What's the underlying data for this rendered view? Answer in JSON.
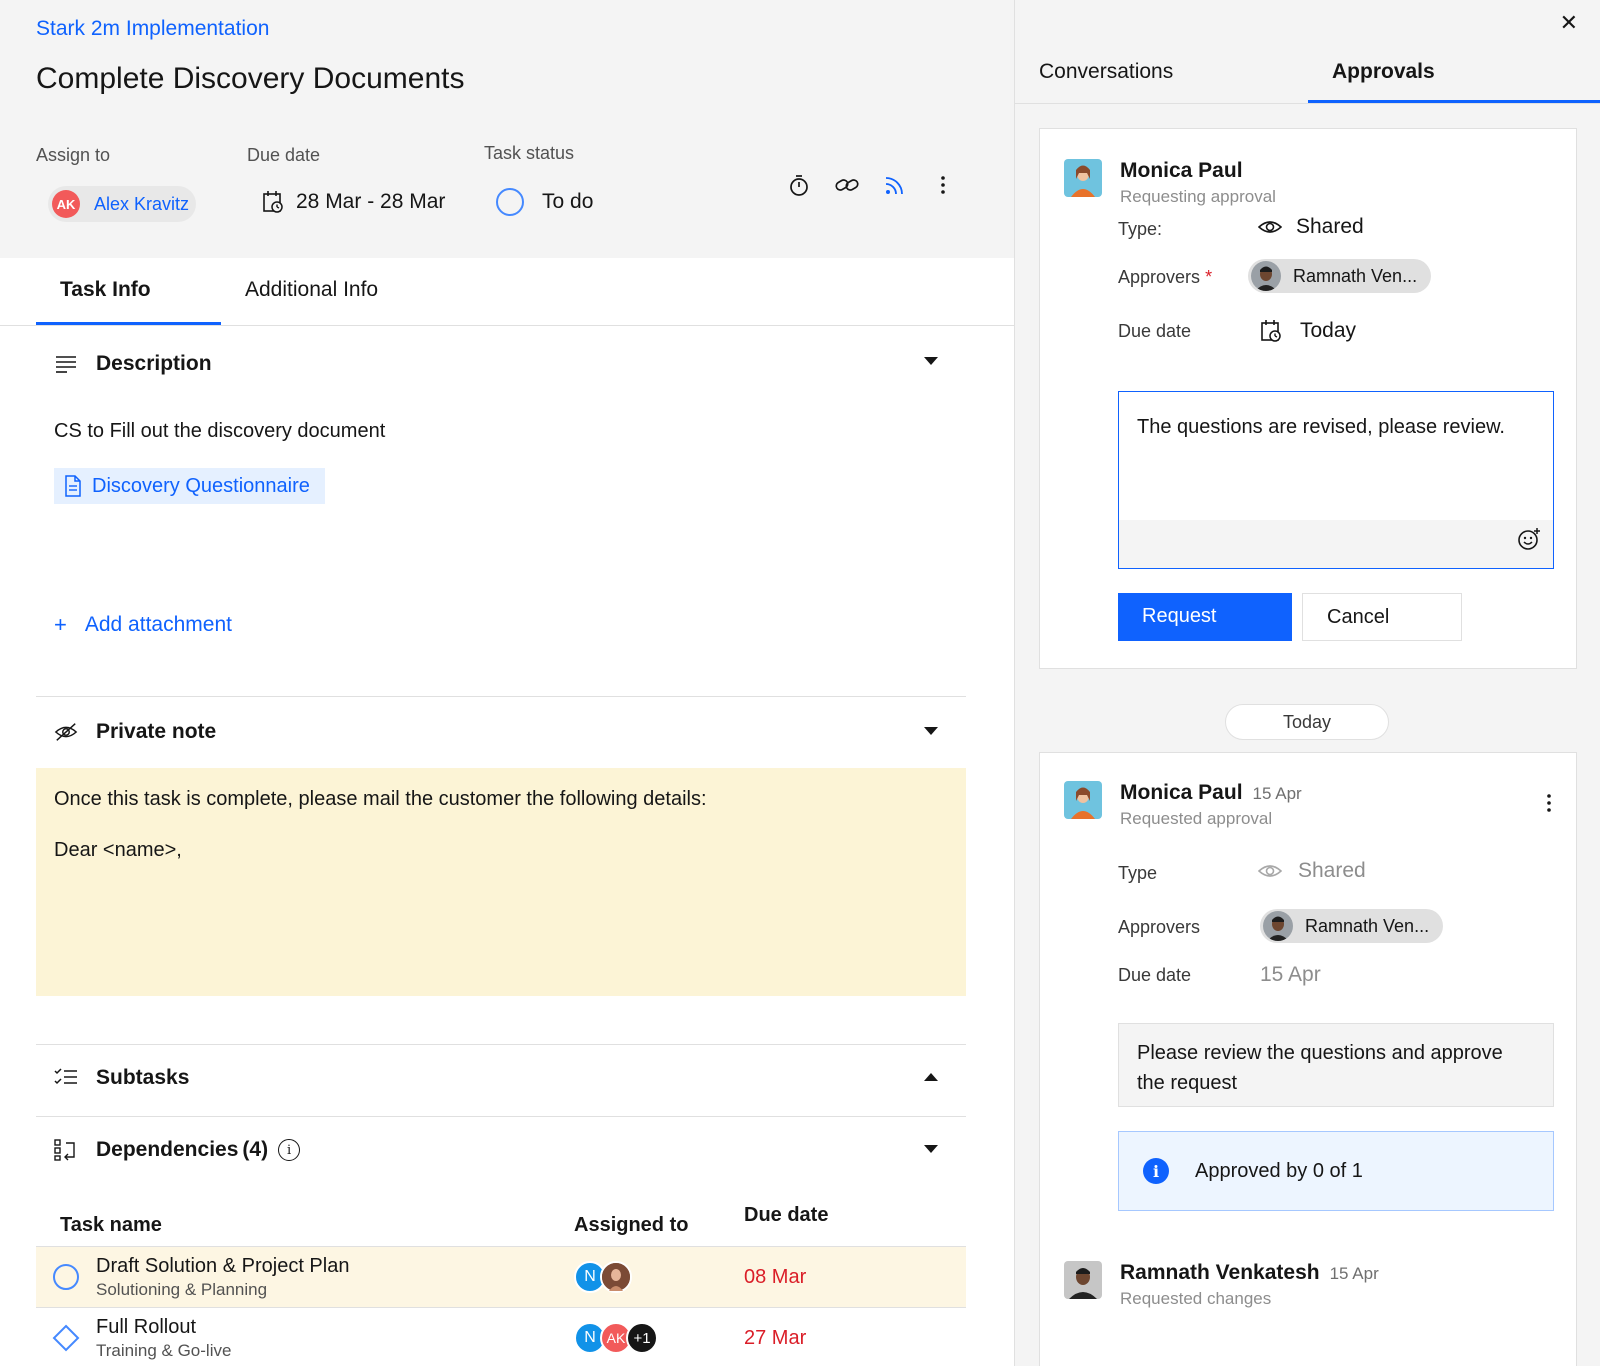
{
  "header": {
    "breadcrumb": "Stark 2m Implementation",
    "title": "Complete Discovery Documents",
    "assign_label": "Assign to",
    "assignee_initials": "AK",
    "assignee_name": "Alex Kravitz",
    "due_label": "Due date",
    "due_value": "28 Mar - 28 Mar",
    "status_label": "Task status",
    "status_value": "To do",
    "icons": [
      "timer-icon",
      "link-icon",
      "rss-icon",
      "overflow-menu-icon"
    ]
  },
  "tabs": [
    {
      "label": "Task Info",
      "active": true
    },
    {
      "label": "Additional Info",
      "active": false
    }
  ],
  "description": {
    "heading": "Description",
    "text": "CS to Fill out the discovery document",
    "attachment": "Discovery Questionnaire",
    "add_attachment": "Add attachment"
  },
  "private_note": {
    "heading": "Private note",
    "line1": "Once this task is complete, please mail the customer the following details:",
    "line2": "Dear <name>,"
  },
  "subtasks": {
    "heading": "Subtasks"
  },
  "dependencies": {
    "heading": "Dependencies",
    "count": "(4)",
    "columns": [
      "Task name",
      "Assigned to",
      "Due date"
    ],
    "rows": [
      {
        "name": "Draft Solution & Project Plan",
        "sub": "Solutioning & Planning",
        "assignees": [
          "N"
        ],
        "due": "08 Mar",
        "icon": "circle"
      },
      {
        "name": "Full Rollout",
        "sub": "Training & Go-live",
        "assignees": [
          "N",
          "AK",
          "+1"
        ],
        "due": "27 Mar",
        "icon": "diamond"
      }
    ]
  },
  "right": {
    "tabs": [
      {
        "label": "Conversations",
        "active": false
      },
      {
        "label": "Approvals",
        "active": true
      }
    ],
    "request_card": {
      "name": "Monica Paul",
      "sub": "Requesting approval",
      "type_label": "Type",
      "type_colon": ":",
      "type_value": "Shared",
      "approvers_label": "Approvers",
      "required_mark": "*",
      "approver": "Ramnath Ven...",
      "due_label": "Due date",
      "due_value": "Today",
      "comment": "The questions are revised, please review.",
      "request_btn": "Request",
      "cancel_btn": "Cancel"
    },
    "day_separator": "Today",
    "history_card": {
      "name": "Monica Paul",
      "date": "15 Apr",
      "sub": "Requested approval",
      "type_label": "Type",
      "type_value": "Shared",
      "approvers_label": "Approvers",
      "approver": "Ramnath Ven...",
      "due_label": "Due date",
      "due_value": "15 Apr",
      "message": "Please review the questions and approve the request",
      "approved_status": "Approved by 0 of 1",
      "reply_name": "Ramnath Venkatesh",
      "reply_date": "15 Apr",
      "reply_sub": "Requested changes"
    }
  },
  "colors": {
    "accent": "#0f62fe",
    "note_bg": "#fcf4d6",
    "overdue": "#da1e28",
    "highlight_row": "#fdf6e3"
  }
}
